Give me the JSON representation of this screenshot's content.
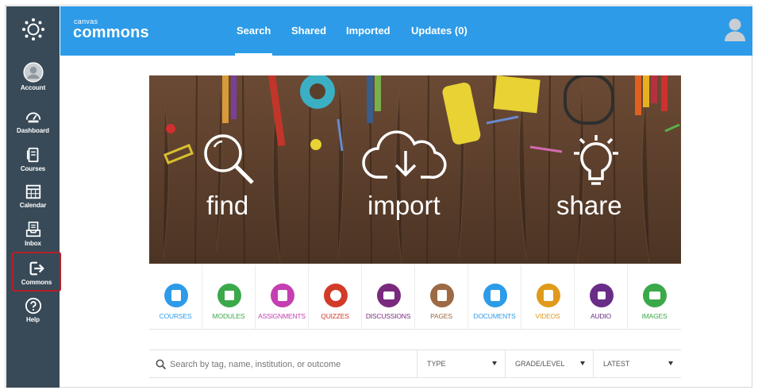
{
  "nav": {
    "items": [
      {
        "label": "Account",
        "icon": "account-icon"
      },
      {
        "label": "Dashboard",
        "icon": "dashboard-icon"
      },
      {
        "label": "Courses",
        "icon": "courses-icon"
      },
      {
        "label": "Calendar",
        "icon": "calendar-icon"
      },
      {
        "label": "Inbox",
        "icon": "inbox-icon"
      },
      {
        "label": "Commons",
        "icon": "commons-icon",
        "active": true
      },
      {
        "label": "Help",
        "icon": "help-icon"
      }
    ]
  },
  "header": {
    "brand_small": "canvas",
    "brand_big": "commons",
    "tabs": [
      "Search",
      "Shared",
      "Imported",
      "Updates (0)"
    ],
    "active_tab": "Search"
  },
  "hero": {
    "find": "find",
    "import": "import",
    "share": "share"
  },
  "categories": [
    {
      "label": "COURSES",
      "color": "#2d9be8"
    },
    {
      "label": "MODULES",
      "color": "#3aa94a"
    },
    {
      "label": "ASSIGNMENTS",
      "color": "#c43fb0"
    },
    {
      "label": "QUIZZES",
      "color": "#d23a2a"
    },
    {
      "label": "DISCUSSIONS",
      "color": "#7a2a7e"
    },
    {
      "label": "PAGES",
      "color": "#9c6a45"
    },
    {
      "label": "DOCUMENTS",
      "color": "#2d9be8"
    },
    {
      "label": "VIDEOS",
      "color": "#e09a1b"
    },
    {
      "label": "AUDIO",
      "color": "#6a2d87"
    },
    {
      "label": "IMAGES",
      "color": "#3aa94a"
    }
  ],
  "search": {
    "placeholder": "Search by tag, name, institution, or outcome",
    "type": "TYPE",
    "grade": "GRADE/LEVEL",
    "sort": "LATEST"
  },
  "colors": {
    "nav_bg": "#384a57",
    "header_bg": "#2d9be8",
    "active_border": "#b4202a"
  }
}
